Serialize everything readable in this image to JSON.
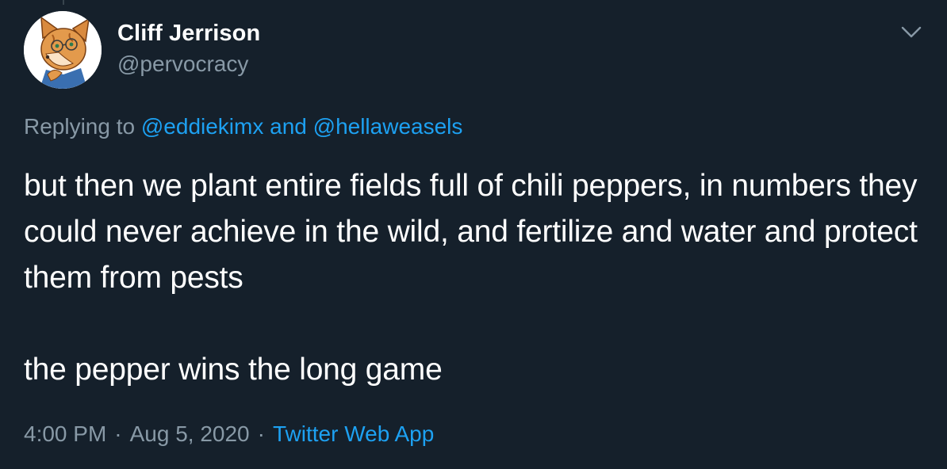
{
  "tweet": {
    "author": {
      "display_name": "Cliff Jerrison",
      "handle": "@pervocracy",
      "avatar_icon": "fox-cartoon-avatar"
    },
    "menu_icon": "chevron-down-icon",
    "reply": {
      "prefix": "Replying to",
      "user1": "@eddiekimx",
      "conjunction": "and",
      "user2": "@hellaweasels"
    },
    "text": {
      "paragraph1": "but then we plant entire fields full of chili peppers, in numbers they could never achieve in the wild, and fertilize and water and protect them from pests",
      "paragraph2": "the pepper wins the long game"
    },
    "meta": {
      "time": "4:00 PM",
      "date": "Aug 5, 2020",
      "separator": "·",
      "source": "Twitter Web App"
    }
  },
  "colors": {
    "background": "#15202b",
    "primary_text": "#ffffff",
    "secondary_text": "#8899a6",
    "link": "#1da1f2"
  }
}
